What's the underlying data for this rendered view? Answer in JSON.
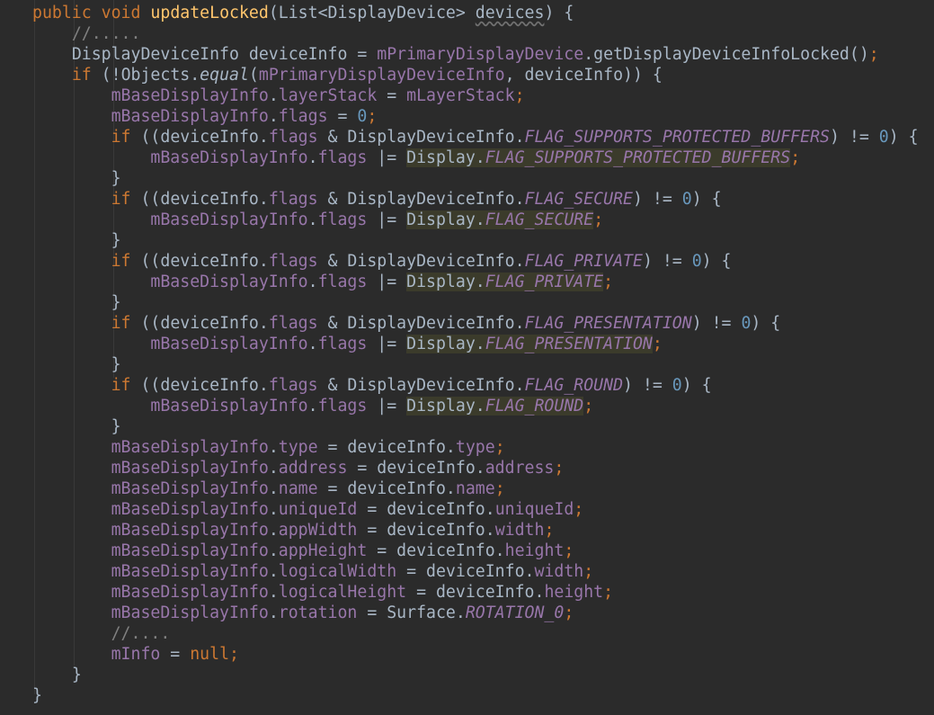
{
  "editor": {
    "language": "java",
    "colors": {
      "background": "#2b2b2b",
      "keyword": "#cc7832",
      "method_declaration": "#ffc66d",
      "text": "#a9b7c6",
      "field": "#9876aa",
      "number": "#6897bb",
      "comment": "#808080",
      "highlight": "#3b3b2b"
    },
    "lines": [
      {
        "indent": 0,
        "tokens": [
          {
            "t": "public",
            "c": "kw"
          },
          {
            "t": " "
          },
          {
            "t": "void",
            "c": "kw"
          },
          {
            "t": " "
          },
          {
            "t": "updateLocked",
            "c": "fn"
          },
          {
            "t": "(List<DisplayDevice> "
          },
          {
            "t": "devices",
            "c": "param"
          },
          {
            "t": ") {"
          }
        ]
      },
      {
        "indent": 1,
        "tokens": [
          {
            "t": "//.....",
            "c": "cmt"
          }
        ]
      },
      {
        "indent": 1,
        "tokens": [
          {
            "t": "DisplayDeviceInfo deviceInfo = "
          },
          {
            "t": "mPrimaryDisplayDevice",
            "c": "field"
          },
          {
            "t": ".getDisplayDeviceInfoLocked()"
          },
          {
            "t": ";",
            "c": "kw"
          }
        ]
      },
      {
        "indent": 1,
        "tokens": [
          {
            "t": "if",
            "c": "kw"
          },
          {
            "t": " (!Objects."
          },
          {
            "t": "equal",
            "c": "ital"
          },
          {
            "t": "("
          },
          {
            "t": "mPrimaryDisplayDeviceInfo",
            "c": "field"
          },
          {
            "t": ", "
          },
          {
            "t": "deviceInfo)) {"
          }
        ]
      },
      {
        "indent": 2,
        "tokens": [
          {
            "t": "mBaseDisplayInfo",
            "c": "field"
          },
          {
            "t": "."
          },
          {
            "t": "layerStack",
            "c": "field"
          },
          {
            "t": " = "
          },
          {
            "t": "mLayerStack",
            "c": "field"
          },
          {
            "t": ";",
            "c": "kw"
          }
        ]
      },
      {
        "indent": 2,
        "tokens": [
          {
            "t": "mBaseDisplayInfo",
            "c": "field"
          },
          {
            "t": "."
          },
          {
            "t": "flags",
            "c": "field"
          },
          {
            "t": " = "
          },
          {
            "t": "0",
            "c": "num"
          },
          {
            "t": ";",
            "c": "kw"
          }
        ]
      },
      {
        "indent": 2,
        "tokens": [
          {
            "t": "if",
            "c": "kw"
          },
          {
            "t": " ((deviceInfo."
          },
          {
            "t": "flags",
            "c": "field"
          },
          {
            "t": " & DisplayDeviceInfo."
          },
          {
            "t": "FLAG_SUPPORTS_PROTECTED_BUFFERS",
            "c": "sfield"
          },
          {
            "t": ") != "
          },
          {
            "t": "0",
            "c": "num"
          },
          {
            "t": ") {"
          }
        ]
      },
      {
        "indent": 3,
        "tokens": [
          {
            "t": "mBaseDisplayInfo",
            "c": "field"
          },
          {
            "t": "."
          },
          {
            "t": "flags",
            "c": "field"
          },
          {
            "t": " |= "
          },
          {
            "t": "Display.",
            "hl": true
          },
          {
            "t": "FLAG_SUPPORTS_PROTECTED_BUFFERS",
            "c": "sfield",
            "hl": true
          },
          {
            "t": ";",
            "c": "kw"
          }
        ]
      },
      {
        "indent": 2,
        "tokens": [
          {
            "t": "}"
          }
        ]
      },
      {
        "indent": 2,
        "tokens": [
          {
            "t": "if",
            "c": "kw"
          },
          {
            "t": " ((deviceInfo."
          },
          {
            "t": "flags",
            "c": "field"
          },
          {
            "t": " & DisplayDeviceInfo."
          },
          {
            "t": "FLAG_SECURE",
            "c": "sfield"
          },
          {
            "t": ") != "
          },
          {
            "t": "0",
            "c": "num"
          },
          {
            "t": ") {"
          }
        ]
      },
      {
        "indent": 3,
        "tokens": [
          {
            "t": "mBaseDisplayInfo",
            "c": "field"
          },
          {
            "t": "."
          },
          {
            "t": "flags",
            "c": "field"
          },
          {
            "t": " |= "
          },
          {
            "t": "Display.",
            "hl": true
          },
          {
            "t": "FLAG_SECURE",
            "c": "sfield",
            "hl": true
          },
          {
            "t": ";",
            "c": "kw"
          }
        ]
      },
      {
        "indent": 2,
        "tokens": [
          {
            "t": "}"
          }
        ]
      },
      {
        "indent": 2,
        "tokens": [
          {
            "t": "if",
            "c": "kw"
          },
          {
            "t": " ((deviceInfo."
          },
          {
            "t": "flags",
            "c": "field"
          },
          {
            "t": " & DisplayDeviceInfo."
          },
          {
            "t": "FLAG_PRIVATE",
            "c": "sfield"
          },
          {
            "t": ") != "
          },
          {
            "t": "0",
            "c": "num"
          },
          {
            "t": ") {"
          }
        ]
      },
      {
        "indent": 3,
        "tokens": [
          {
            "t": "mBaseDisplayInfo",
            "c": "field"
          },
          {
            "t": "."
          },
          {
            "t": "flags",
            "c": "field"
          },
          {
            "t": " |= "
          },
          {
            "t": "Display.",
            "hl": true
          },
          {
            "t": "FLAG_PRIVATE",
            "c": "sfield",
            "hl": true
          },
          {
            "t": ";",
            "c": "kw"
          }
        ]
      },
      {
        "indent": 2,
        "tokens": [
          {
            "t": "}"
          }
        ]
      },
      {
        "indent": 2,
        "tokens": [
          {
            "t": "if",
            "c": "kw"
          },
          {
            "t": " ((deviceInfo."
          },
          {
            "t": "flags",
            "c": "field"
          },
          {
            "t": " & DisplayDeviceInfo."
          },
          {
            "t": "FLAG_PRESENTATION",
            "c": "sfield"
          },
          {
            "t": ") != "
          },
          {
            "t": "0",
            "c": "num"
          },
          {
            "t": ") {"
          }
        ]
      },
      {
        "indent": 3,
        "tokens": [
          {
            "t": "mBaseDisplayInfo",
            "c": "field"
          },
          {
            "t": "."
          },
          {
            "t": "flags",
            "c": "field"
          },
          {
            "t": " |= "
          },
          {
            "t": "Display.",
            "hl": true
          },
          {
            "t": "FLAG_PRESENTATION",
            "c": "sfield",
            "hl": true
          },
          {
            "t": ";",
            "c": "kw"
          }
        ]
      },
      {
        "indent": 2,
        "tokens": [
          {
            "t": "}"
          }
        ]
      },
      {
        "indent": 2,
        "tokens": [
          {
            "t": "if",
            "c": "kw"
          },
          {
            "t": " ((deviceInfo."
          },
          {
            "t": "flags",
            "c": "field"
          },
          {
            "t": " & DisplayDeviceInfo."
          },
          {
            "t": "FLAG_ROUND",
            "c": "sfield"
          },
          {
            "t": ") != "
          },
          {
            "t": "0",
            "c": "num"
          },
          {
            "t": ") {"
          }
        ]
      },
      {
        "indent": 3,
        "tokens": [
          {
            "t": "mBaseDisplayInfo",
            "c": "field"
          },
          {
            "t": "."
          },
          {
            "t": "flags",
            "c": "field"
          },
          {
            "t": " |= "
          },
          {
            "t": "Display.",
            "hl": true
          },
          {
            "t": "FLAG_ROUND",
            "c": "sfield",
            "hl": true
          },
          {
            "t": ";",
            "c": "kw"
          }
        ]
      },
      {
        "indent": 2,
        "tokens": [
          {
            "t": "}"
          }
        ]
      },
      {
        "indent": 2,
        "tokens": [
          {
            "t": "mBaseDisplayInfo",
            "c": "field"
          },
          {
            "t": "."
          },
          {
            "t": "type",
            "c": "field"
          },
          {
            "t": " = deviceInfo."
          },
          {
            "t": "type",
            "c": "field"
          },
          {
            "t": ";",
            "c": "kw"
          }
        ]
      },
      {
        "indent": 2,
        "tokens": [
          {
            "t": "mBaseDisplayInfo",
            "c": "field"
          },
          {
            "t": "."
          },
          {
            "t": "address",
            "c": "field"
          },
          {
            "t": " = deviceInfo."
          },
          {
            "t": "address",
            "c": "field"
          },
          {
            "t": ";",
            "c": "kw"
          }
        ]
      },
      {
        "indent": 2,
        "tokens": [
          {
            "t": "mBaseDisplayInfo",
            "c": "field"
          },
          {
            "t": "."
          },
          {
            "t": "name",
            "c": "field"
          },
          {
            "t": " = deviceInfo."
          },
          {
            "t": "name",
            "c": "field"
          },
          {
            "t": ";",
            "c": "kw"
          }
        ]
      },
      {
        "indent": 2,
        "tokens": [
          {
            "t": "mBaseDisplayInfo",
            "c": "field"
          },
          {
            "t": "."
          },
          {
            "t": "uniqueId",
            "c": "field"
          },
          {
            "t": " = deviceInfo."
          },
          {
            "t": "uniqueId",
            "c": "field"
          },
          {
            "t": ";",
            "c": "kw"
          }
        ]
      },
      {
        "indent": 2,
        "tokens": [
          {
            "t": "mBaseDisplayInfo",
            "c": "field"
          },
          {
            "t": "."
          },
          {
            "t": "appWidth",
            "c": "field"
          },
          {
            "t": " = deviceInfo."
          },
          {
            "t": "width",
            "c": "field"
          },
          {
            "t": ";",
            "c": "kw"
          }
        ]
      },
      {
        "indent": 2,
        "tokens": [
          {
            "t": "mBaseDisplayInfo",
            "c": "field"
          },
          {
            "t": "."
          },
          {
            "t": "appHeight",
            "c": "field"
          },
          {
            "t": " = deviceInfo."
          },
          {
            "t": "height",
            "c": "field"
          },
          {
            "t": ";",
            "c": "kw"
          }
        ]
      },
      {
        "indent": 2,
        "tokens": [
          {
            "t": "mBaseDisplayInfo",
            "c": "field"
          },
          {
            "t": "."
          },
          {
            "t": "logicalWidth",
            "c": "field"
          },
          {
            "t": " = deviceInfo."
          },
          {
            "t": "width",
            "c": "field"
          },
          {
            "t": ";",
            "c": "kw"
          }
        ]
      },
      {
        "indent": 2,
        "tokens": [
          {
            "t": "mBaseDisplayInfo",
            "c": "field"
          },
          {
            "t": "."
          },
          {
            "t": "logicalHeight",
            "c": "field"
          },
          {
            "t": " = deviceInfo."
          },
          {
            "t": "height",
            "c": "field"
          },
          {
            "t": ";",
            "c": "kw"
          }
        ]
      },
      {
        "indent": 2,
        "tokens": [
          {
            "t": "mBaseDisplayInfo",
            "c": "field"
          },
          {
            "t": "."
          },
          {
            "t": "rotation",
            "c": "field"
          },
          {
            "t": " = Surface."
          },
          {
            "t": "ROTATION_0",
            "c": "sfield"
          },
          {
            "t": ";",
            "c": "kw"
          }
        ]
      },
      {
        "indent": 2,
        "tokens": [
          {
            "t": "//....",
            "c": "cmt"
          }
        ]
      },
      {
        "indent": 2,
        "tokens": [
          {
            "t": "mInfo",
            "c": "field"
          },
          {
            "t": " = "
          },
          {
            "t": "null",
            "c": "kw"
          },
          {
            "t": ";",
            "c": "kw"
          }
        ]
      },
      {
        "indent": 1,
        "tokens": [
          {
            "t": "}"
          }
        ]
      },
      {
        "indent": 0,
        "tokens": [
          {
            "t": "}"
          }
        ]
      }
    ]
  }
}
